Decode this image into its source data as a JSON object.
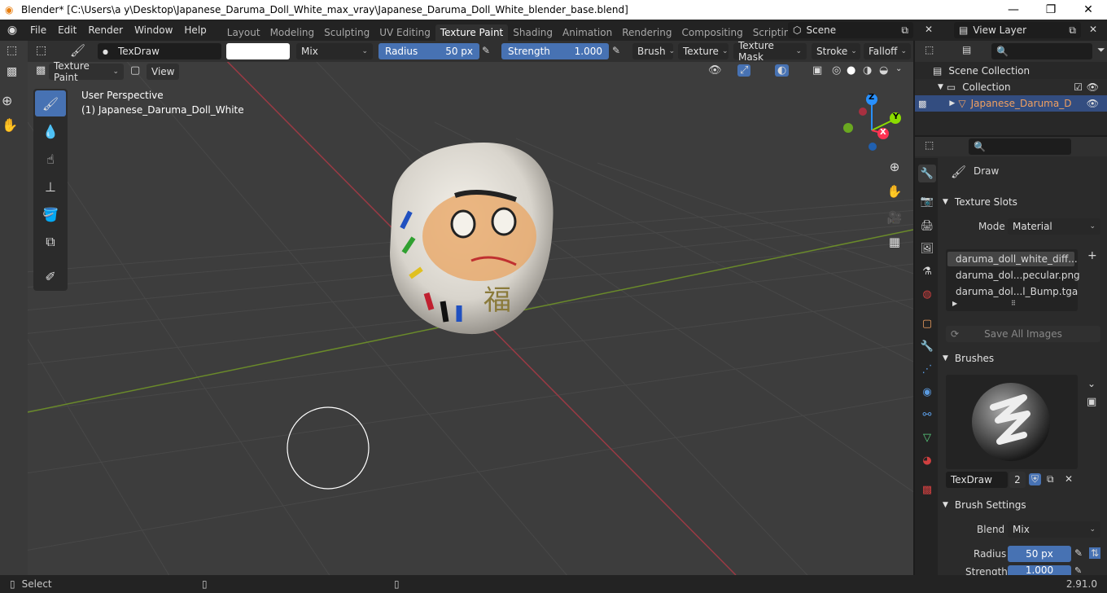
{
  "titlebar": {
    "title": "Blender* [C:\\Users\\a y\\Desktop\\Japanese_Daruma_Doll_White_max_vray\\Japanese_Daruma_Doll_White_blender_base.blend]",
    "minimize": "—",
    "maximize": "❐",
    "close": "✕"
  },
  "menu": {
    "items": [
      "File",
      "Edit",
      "Render",
      "Window",
      "Help"
    ]
  },
  "workspaces": {
    "tabs": [
      "Layout",
      "Modeling",
      "Sculpting",
      "UV Editing",
      "Texture Paint",
      "Shading",
      "Animation",
      "Rendering",
      "Compositing",
      "Scripting"
    ],
    "active": "Texture Paint",
    "add": "+"
  },
  "scene": {
    "name": "Scene",
    "view_layer": "View Layer"
  },
  "toolsettings": {
    "brush_name": "TexDraw",
    "blend": "Mix",
    "radius_label": "Radius",
    "radius_value": "50 px",
    "strength_label": "Strength",
    "strength_value": "1.000",
    "menus": [
      "Brush",
      "Texture",
      "Texture Mask",
      "Stroke",
      "Falloff"
    ]
  },
  "viewport_header": {
    "mode": "Texture Paint",
    "view": "View"
  },
  "viewport": {
    "perspective": "User Perspective",
    "object": "(1) Japanese_Daruma_Doll_White",
    "gizmo": {
      "x": "X",
      "y": "Y",
      "z": "Z"
    }
  },
  "outliner": {
    "scene_collection": "Scene Collection",
    "collection": "Collection",
    "object": "Japanese_Daruma_D"
  },
  "properties": {
    "tool_name": "Draw",
    "texture_slots_title": "Texture Slots",
    "mode_label": "Mode",
    "mode_value": "Material",
    "slots": [
      "daruma_doll_white_diff...",
      "daruma_dol...pecular.png",
      "daruma_dol...l_Bump.tga"
    ],
    "save_all": "Save All Images",
    "brushes_title": "Brushes",
    "brush_name": "TexDraw",
    "brush_users": "2",
    "brush_settings_title": "Brush Settings",
    "blend_label": "Blend",
    "blend_value": "Mix",
    "radius_label": "Radius",
    "radius_value": "50 px",
    "strength_label": "Strength",
    "strength_value": "1.000"
  },
  "status": {
    "select": "Select",
    "version": "2.91.0"
  },
  "colors": {
    "accent": "#4772b3",
    "x_axis": "#ff3352",
    "y_axis": "#8bdc00",
    "z_axis": "#2890ff",
    "object_highlight": "#f0a060"
  }
}
